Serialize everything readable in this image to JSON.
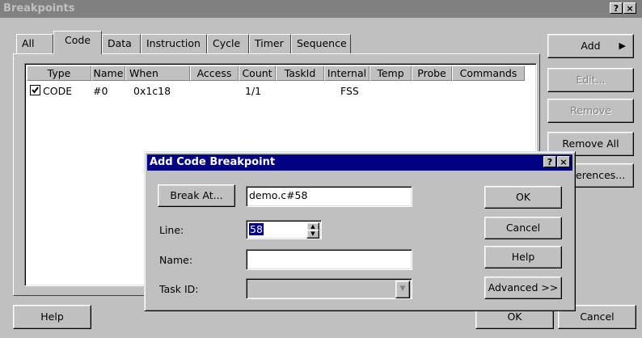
{
  "window": {
    "title": "Breakpoints",
    "help_glyph": "?",
    "close_glyph": "×"
  },
  "tabs": [
    "All",
    "Code",
    "Data",
    "Instruction",
    "Cycle",
    "Timer",
    "Sequence"
  ],
  "columns": [
    "Type",
    "Name",
    "When",
    "Access",
    "Count",
    "TaskId",
    "Internal",
    "Temp",
    "Probe",
    "Commands"
  ],
  "row": {
    "type": "CODE",
    "name": "#0",
    "when": "0x1c18",
    "access": "",
    "count": "1/1",
    "taskid": "",
    "internal": "FSS",
    "temp": "",
    "probe": "",
    "commands": "",
    "checked": true
  },
  "side_buttons": {
    "add": "Add",
    "edit": "Edit...",
    "remove": "Remove",
    "remove_all": "Remove All",
    "preferences": "Preferences..."
  },
  "bottom_buttons": {
    "help": "Help",
    "ok": "OK",
    "cancel": "Cancel"
  },
  "dialog": {
    "title": "Add Code Breakpoint",
    "break_at_label": "Break At...",
    "break_at_value": "demo.c#58",
    "line_label": "Line:",
    "line_value": "58",
    "name_label": "Name:",
    "name_value": "",
    "taskid_label": "Task ID:",
    "taskid_value": "",
    "ok": "OK",
    "cancel": "Cancel",
    "help": "Help",
    "advanced": "Advanced >>"
  },
  "colors": {
    "face": "#c0c0c0",
    "active_title": "#000080",
    "inactive_title": "#808080",
    "selection": "#000080"
  }
}
